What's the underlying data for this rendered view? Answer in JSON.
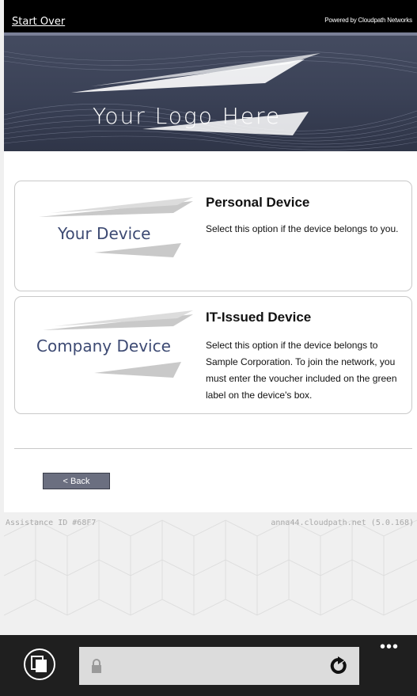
{
  "header": {
    "start_over": "Start Over",
    "powered_by": "Powered by Cloudpath Networks"
  },
  "banner": {
    "logo_text": "Your Logo Here"
  },
  "options": [
    {
      "image_text": "Your Device",
      "title": "Personal Device",
      "description": "Select this option if the device belongs to you."
    },
    {
      "image_text": "Company Device",
      "title": "IT-Issued Device",
      "description": "Select this option if the device belongs to Sample Corporation. To join the network, you must enter the voucher included on the green label on the device's box."
    }
  ],
  "back_label": "< Back",
  "footer": {
    "assistance_id": "Assistance ID #68F7",
    "server": "anna44.cloudpath.net (5.0.168)"
  },
  "browser_bar": {
    "icons": [
      "tabs-icon",
      "lock-icon",
      "refresh-icon",
      "more-icon"
    ],
    "more": "•••"
  }
}
